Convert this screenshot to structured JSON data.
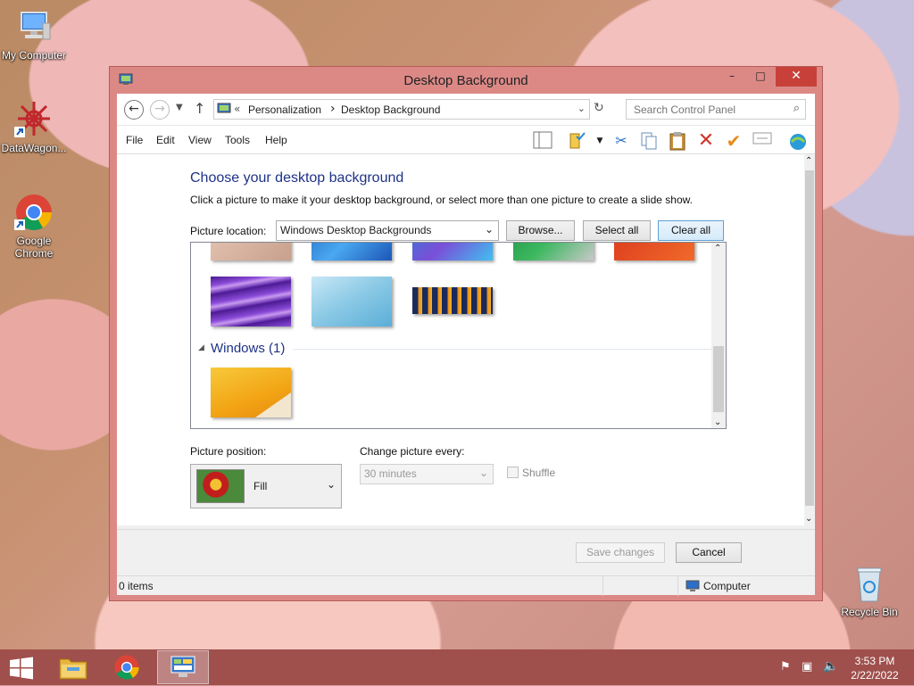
{
  "desktop": {
    "icons": [
      {
        "label": "My Computer"
      },
      {
        "label": "DataWagon..."
      },
      {
        "label": "Google Chrome"
      },
      {
        "label": "Recycle Bin"
      }
    ]
  },
  "window": {
    "title": "Desktop Background",
    "controls": {
      "minimize": "–",
      "maximize": "□",
      "close": "✕"
    },
    "address": {
      "prefix": "«",
      "crumbs": [
        "Personalization",
        "Desktop Background"
      ],
      "separator": "›"
    },
    "search": {
      "placeholder": "Search Control Panel"
    },
    "menu": [
      "File",
      "Edit",
      "View",
      "Tools",
      "Help"
    ],
    "toolbar_icons": [
      "layout-icon",
      "properties-icon",
      "cut-icon",
      "copy-icon",
      "paste-icon",
      "delete-icon",
      "check-icon",
      "rename-icon",
      "web-icon"
    ]
  },
  "main": {
    "heading": "Choose your desktop background",
    "description": "Click a picture to make it your desktop background, or select more than one picture to create a slide show.",
    "picture_location_label": "Picture location:",
    "picture_location_value": "Windows Desktop Backgrounds",
    "browse_label": "Browse...",
    "select_all_label": "Select all",
    "clear_all_label": "Clear all",
    "group_label": "Windows (1)",
    "picture_position_label": "Picture position:",
    "picture_position_value": "Fill",
    "change_picture_label": "Change picture every:",
    "change_picture_value": "30 minutes",
    "shuffle_label": "Shuffle",
    "thumb_colors": {
      "row1": [
        "#d8b6a6",
        "#2a7fd0",
        "#3a9ce8",
        "#2ea04d",
        "#e8502a"
      ],
      "row2": [
        "#6a2fb0",
        "#8ecbe6",
        "#d47a1a"
      ],
      "windows": [
        "#f5b321"
      ]
    }
  },
  "footer": {
    "save_label": "Save changes",
    "cancel_label": "Cancel"
  },
  "status": {
    "items": "0 items",
    "location": "Computer"
  },
  "taskbar": {
    "time": "3:53 PM",
    "date": "2/22/2022"
  }
}
